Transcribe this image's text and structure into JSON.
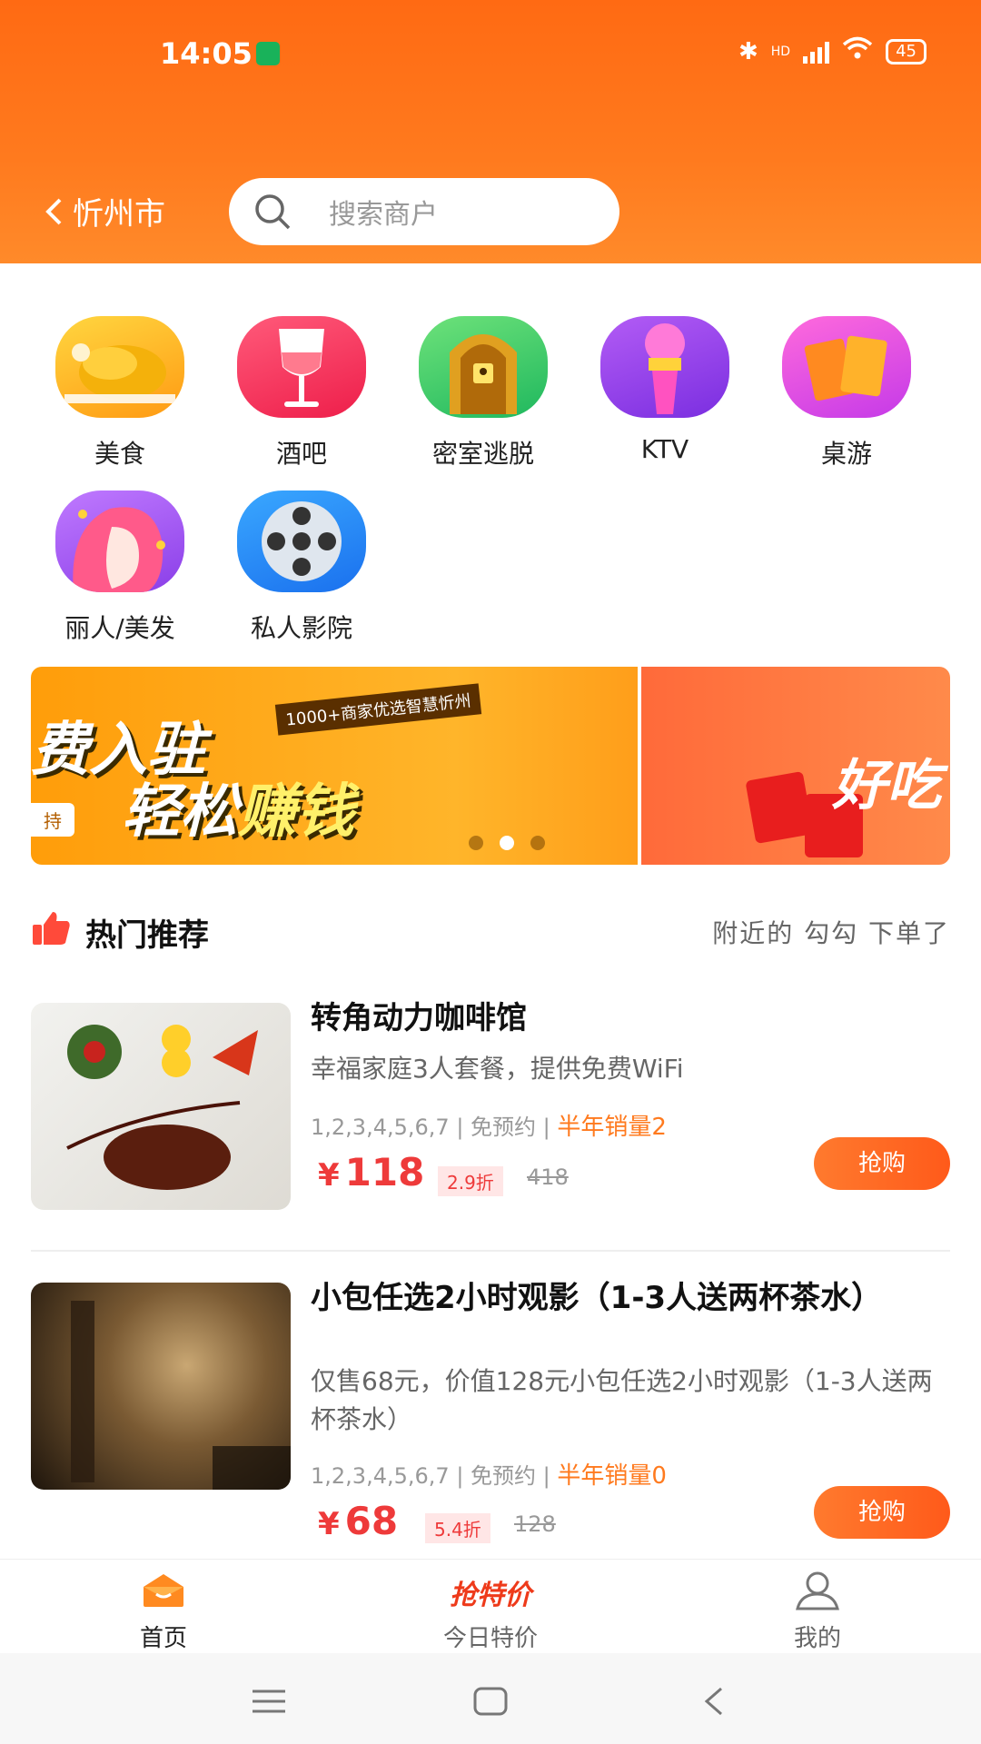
{
  "status_bar": {
    "time": "14:05",
    "battery": "45",
    "network": "HD"
  },
  "header": {
    "city": "忻州市",
    "search_placeholder": "搜索商户"
  },
  "categories": [
    {
      "label": "美食",
      "icon": "roast-chicken-icon"
    },
    {
      "label": "酒吧",
      "icon": "wine-glass-icon"
    },
    {
      "label": "密室逃脱",
      "icon": "locked-door-icon"
    },
    {
      "label": "KTV",
      "icon": "microphone-icon"
    },
    {
      "label": "桌游",
      "icon": "cards-icon"
    },
    {
      "label": "丽人/美发",
      "icon": "beauty-icon"
    },
    {
      "label": "私人影院",
      "icon": "film-reel-icon"
    }
  ],
  "banner": {
    "line1": "费入驻",
    "line2_a": "轻松",
    "line2_b": "赚钱",
    "tag": "1000+商家优选智慧忻州",
    "chip": "持",
    "side_slogan": "好吃",
    "dots": 3,
    "active_dot": 1
  },
  "section": {
    "title": "热门推荐",
    "subtitle": "附近的 勾勾 下单了"
  },
  "products": [
    {
      "name": "转角动力咖啡馆",
      "desc": "幸福家庭3人套餐，提供免费WiFi",
      "days": "1,2,3,4,5,6,7",
      "booking": "免预约",
      "sales": "半年销量2",
      "price": "118",
      "currency": "¥",
      "discount": "2.9折",
      "original": "418",
      "buy": "抢购"
    },
    {
      "name": "小包任选2小时观影（1-3人送两杯茶水）",
      "desc": "仅售68元，价值128元小包任选2小时观影（1-3人送两杯茶水）",
      "days": "1,2,3,4,5,6,7",
      "booking": "免预约",
      "sales": "半年销量0",
      "price": "68",
      "currency": "¥",
      "discount": "5.4折",
      "original": "128",
      "buy": "抢购"
    }
  ],
  "tabbar": {
    "home": "首页",
    "special": "今日特价",
    "special_logo": "抢特价",
    "mine": "我的"
  },
  "colors": {
    "brand": "#ff6a13",
    "price": "#ee3a3a",
    "sales": "#ff7a1e"
  }
}
